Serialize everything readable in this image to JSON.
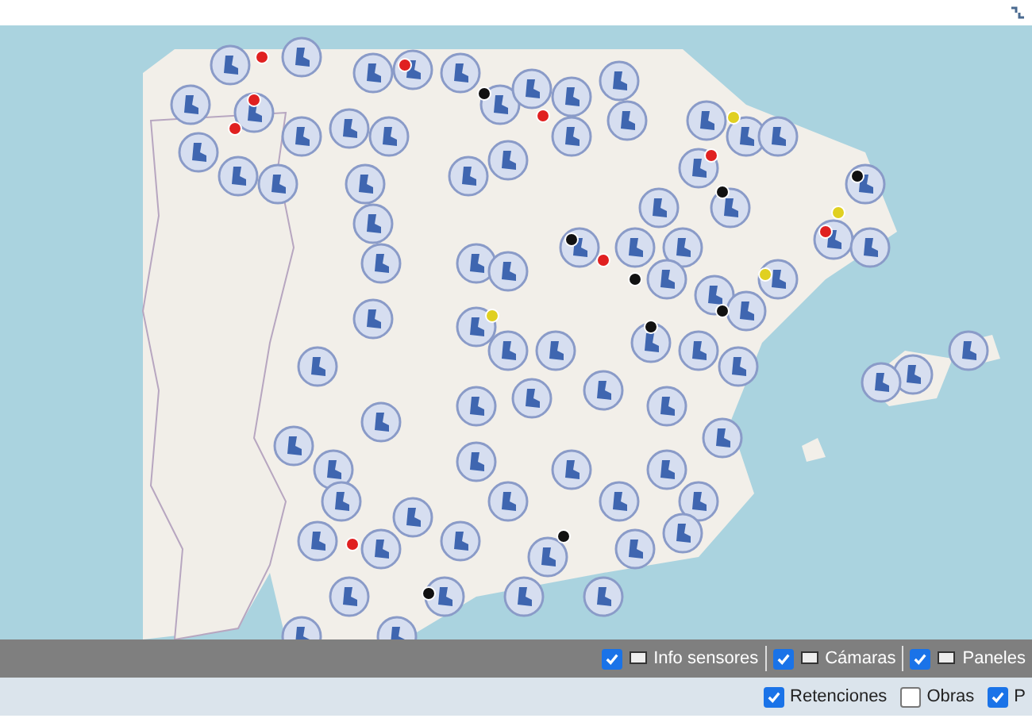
{
  "layers_bar": [
    {
      "label": "Info sensores",
      "checked": true
    },
    {
      "label": "Cámaras",
      "checked": true
    },
    {
      "label": "Paneles",
      "checked": true
    }
  ],
  "incidents_bar": [
    {
      "label": "Retenciones",
      "checked": true
    },
    {
      "label": "Obras",
      "checked": false
    },
    {
      "label": "P",
      "checked": true
    }
  ]
}
